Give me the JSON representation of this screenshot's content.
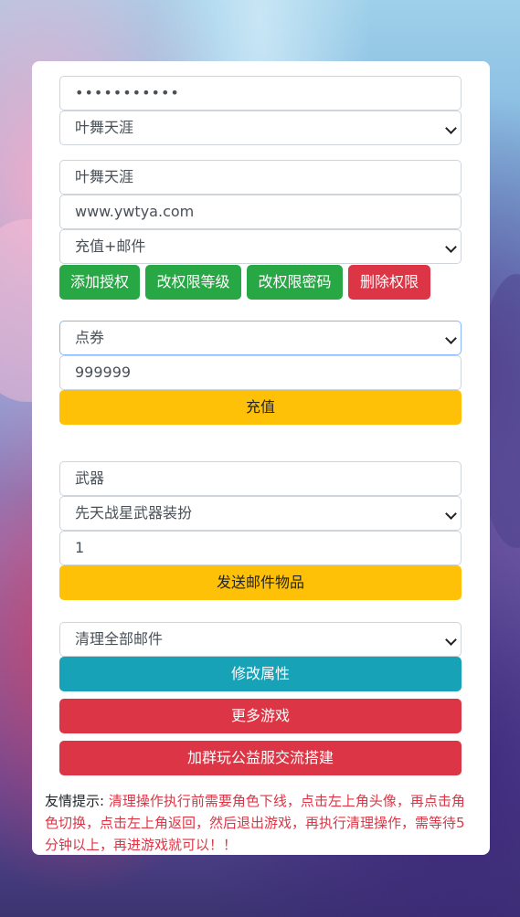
{
  "account": {
    "password_masked": "•••••••••••",
    "server_select": "叶舞天涯"
  },
  "auth": {
    "role_name": "叶舞天涯",
    "website": "www.ywtya.com",
    "permission_select": "充值+邮件",
    "buttons": {
      "add": "添加授权",
      "change_level": "改权限等级",
      "change_password": "改权限密码",
      "delete": "删除权限"
    }
  },
  "recharge": {
    "currency_select": "点券",
    "amount": "999999",
    "button": "充值"
  },
  "mail": {
    "category": "武器",
    "item_select": "先天战星武器装扮",
    "quantity": "1",
    "button": "发送邮件物品"
  },
  "misc": {
    "clear_select": "清理全部邮件",
    "modify_attr_button": "修改属性",
    "more_games_button": "更多游戏",
    "join_group_button": "加群玩公益服交流搭建"
  },
  "tip": {
    "label": "友情提示:",
    "text": "清理操作执行前需要角色下线，点击左上角头像，再点击角色切换，点击左上角返回，然后退出游戏，再执行清理操作，需等待5分钟以上，再进游戏就可以！！"
  },
  "colors": {
    "green": "#28a745",
    "red": "#dc3545",
    "yellow": "#ffc107",
    "teal": "#17a2b8"
  }
}
